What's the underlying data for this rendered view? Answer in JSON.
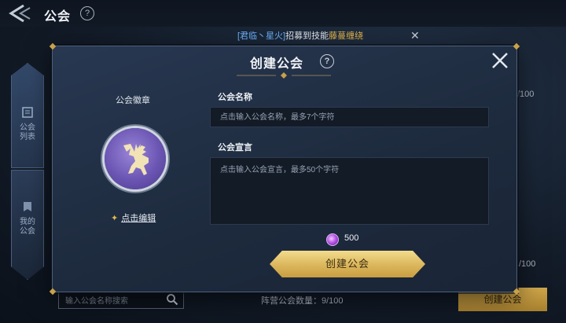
{
  "header": {
    "title": "公会",
    "help": "?"
  },
  "banner": {
    "who": "[君临丶星火]",
    "middle": "招募到技能",
    "skill": "藤蔓缠绕",
    "close": "✕"
  },
  "side_tabs": [
    {
      "label": "公会\n列表"
    },
    {
      "label": "我的\n公会"
    }
  ],
  "background": {
    "count_top": "/100",
    "count_bottom": "/100",
    "search_placeholder": "输入公会名称搜索",
    "faction_count": "阵营公会数量：9/100",
    "create_button": "创建公会"
  },
  "modal": {
    "title": "创建公会",
    "help": "?",
    "emblem_label": "公会徽章",
    "edit_link": "点击编辑",
    "name_label": "公会名称",
    "name_placeholder": "点击输入公会名称，最多7个字符",
    "decl_label": "公会宣言",
    "decl_placeholder": "点击输入公会宣言，最多50个字符",
    "cost": "500",
    "create_button": "创建公会"
  },
  "colors": {
    "gold": "#dbb65c",
    "accent_blue": "#6fb4ff",
    "skill_gold": "#e5b74e",
    "emblem_purple": "#6b55b3"
  }
}
